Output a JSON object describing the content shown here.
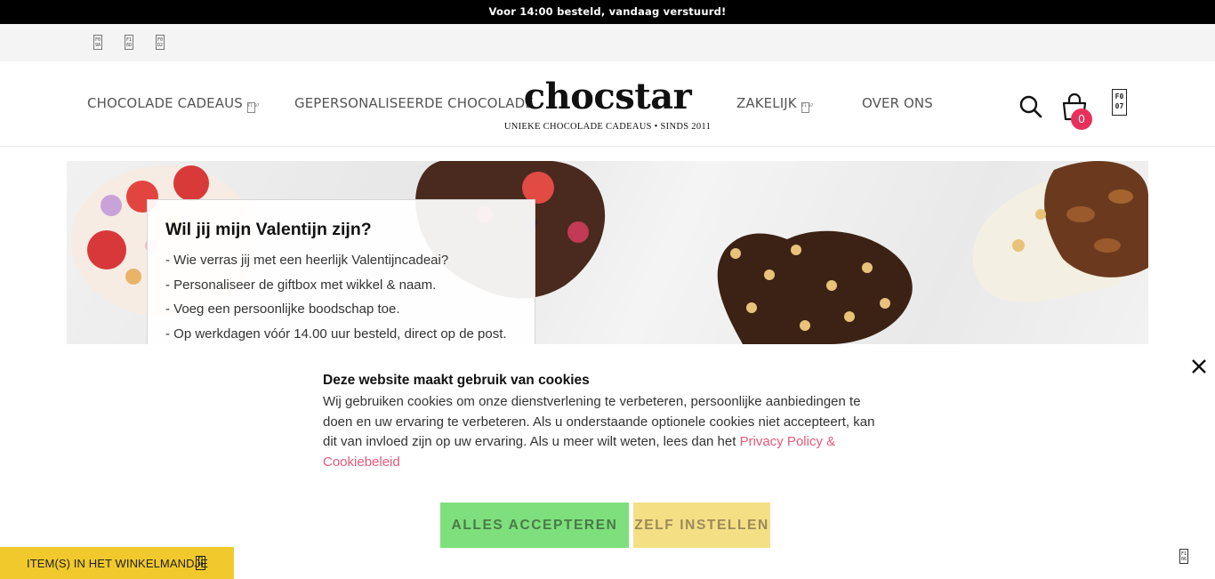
{
  "promo": {
    "text": "Voor 14:00 besteld, vandaag verstuurd!"
  },
  "social": {
    "icons": [
      "facebook-icon",
      "instagram-icon",
      "pinterest-icon"
    ],
    "glyphs": [
      "F0\n9A",
      "F1\n6D",
      "F0\nD2"
    ]
  },
  "nav": {
    "left": [
      {
        "label": "CHOCOLADE CADEAUS",
        "glyph": "F1\n07"
      },
      {
        "label": "GEPERSONALISEERDE CHOCOLADE"
      }
    ],
    "right": [
      {
        "label": "ZAKELIJK",
        "glyph": "F1\n07"
      },
      {
        "label": "OVER ONS"
      }
    ]
  },
  "logo": {
    "word": "chocstar",
    "tagline": "UNIEKE CHOCOLADE CADEAUS • SINDS 2011"
  },
  "cart": {
    "count": "0"
  },
  "account": {
    "glyph": "F0\n07"
  },
  "hero": {
    "title": "Wil jij mijn Valentijn zijn?",
    "bullets": [
      "- Wie verras jij met een heerlijk Valentijncadeai?",
      "- Personaliseer de giftbox met wikkel & naam.",
      "- Voeg een persoonlijke boodschap toe.",
      "- Op werkdagen vóór 14.00 uur besteld, direct op de post."
    ]
  },
  "cookie": {
    "title": "Deze website maakt gebruik van cookies",
    "text": "Wij gebruiken cookies om onze dienstverlening te verbeteren, persoonlijke aanbiedingen te doen en uw ervaring te verbeteren. Als u onderstaande optionele cookies niet accepteert, kan dit van invloed zijn op uw ervaring. Als u meer wilt weten, lees dan het ",
    "link": "Privacy Policy & Cookiebeleid",
    "accept": "ALLES ACCEPTEREN",
    "custom": "ZELF INSTELLEN"
  },
  "cart_bar": {
    "label": "ITEM(S) IN HET WINKELMANDJE",
    "glyph": "F1\n06"
  },
  "corner": {
    "glyph": "F1\n06"
  },
  "colors": {
    "accent": "#e8305c",
    "link": "#e8587a",
    "accept": "#7ee07c",
    "custom": "#f5df84",
    "cart_bar": "#f1c92c"
  }
}
